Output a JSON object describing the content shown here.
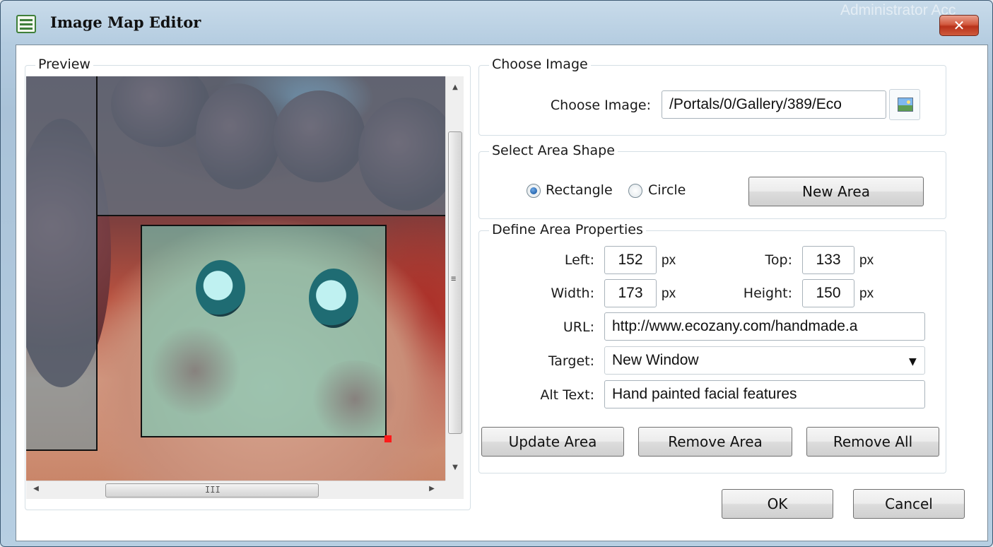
{
  "window": {
    "title": "Image Map Editor",
    "background_text": "Administrator Acc",
    "close_symbol": "✕"
  },
  "preview": {
    "legend": "Preview",
    "grip_symbol": "≡",
    "hgrip_symbol": "III",
    "up_arrow": "▲",
    "down_arrow": "▼",
    "left_arrow": "◀",
    "right_arrow": "▶"
  },
  "choose_image": {
    "legend": "Choose Image",
    "label": "Choose Image:",
    "value": "/Portals/0/Gallery/389/Eco",
    "browse_icon": "image-browse-icon"
  },
  "area_shape": {
    "legend": "Select Area Shape",
    "options": [
      {
        "label": "Rectangle",
        "checked": true
      },
      {
        "label": "Circle",
        "checked": false
      }
    ],
    "new_area_label": "New Area"
  },
  "area_properties": {
    "legend": "Define Area Properties",
    "left_label": "Left:",
    "left_value": "152",
    "top_label": "Top:",
    "top_value": "133",
    "width_label": "Width:",
    "width_value": "173",
    "height_label": "Height:",
    "height_value": "150",
    "unit": "px",
    "url_label": "URL:",
    "url_value": "http://www.ecozany.com/handmade.a",
    "target_label": "Target:",
    "target_value": "New Window",
    "alt_label": "Alt Text:",
    "alt_value": "Hand painted facial features",
    "update_label": "Update Area",
    "remove_label": "Remove Area",
    "remove_all_label": "Remove All"
  },
  "footer": {
    "ok_label": "OK",
    "cancel_label": "Cancel"
  },
  "colors": {
    "selected_area": "#6edcc8",
    "handle": "#ff1a1a",
    "close_button": "#c8442a"
  }
}
